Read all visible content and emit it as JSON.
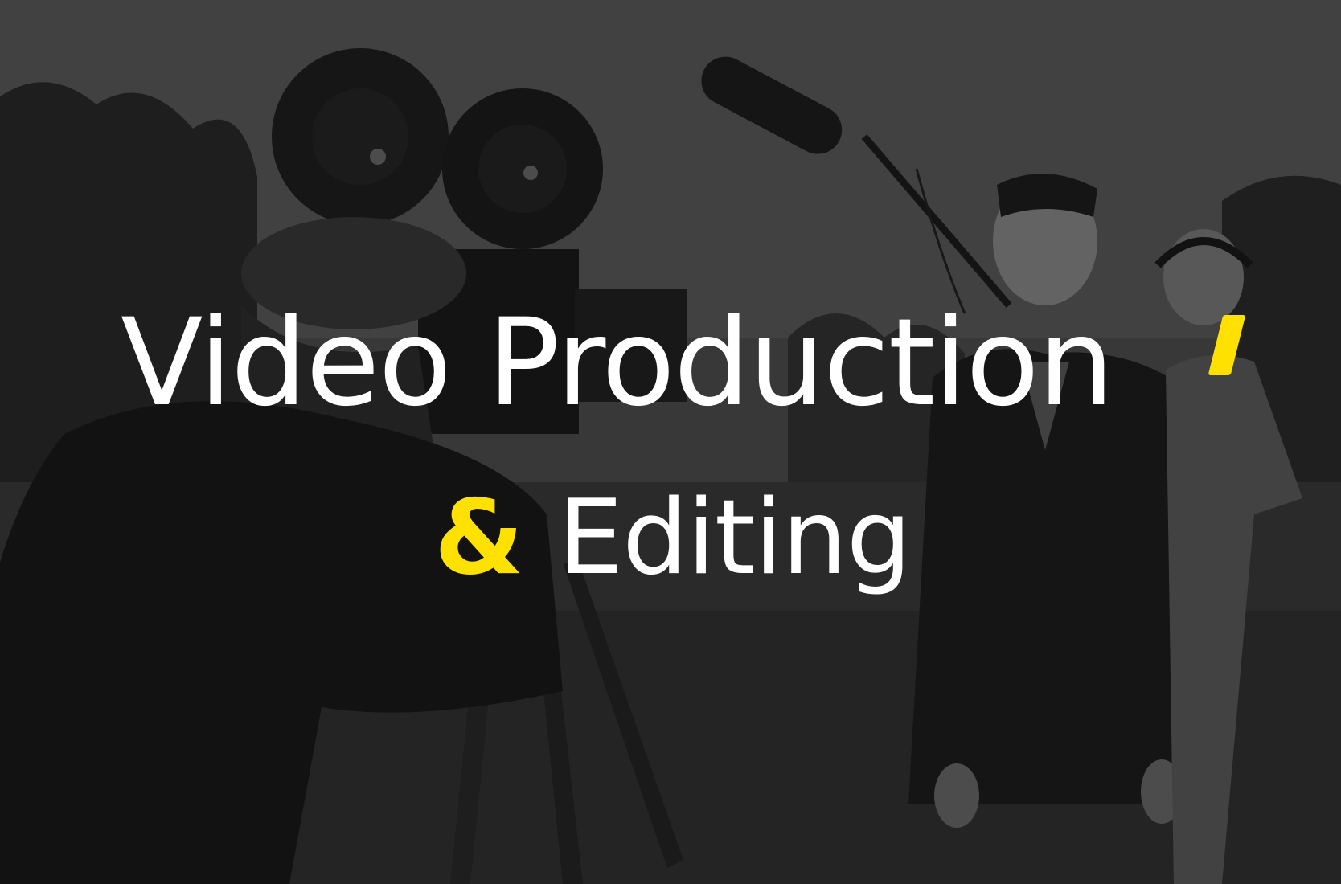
{
  "hero": {
    "title_line1": "Video Production",
    "title_ampersand": "&",
    "title_line2": "Editing"
  },
  "colors": {
    "accent": "#ffe100",
    "text": "#ffffff",
    "background": "#3a3a3a"
  },
  "image": {
    "description": "black-and-white film crew scene",
    "icons": [
      "film-camera-icon",
      "boom-microphone-icon"
    ]
  }
}
